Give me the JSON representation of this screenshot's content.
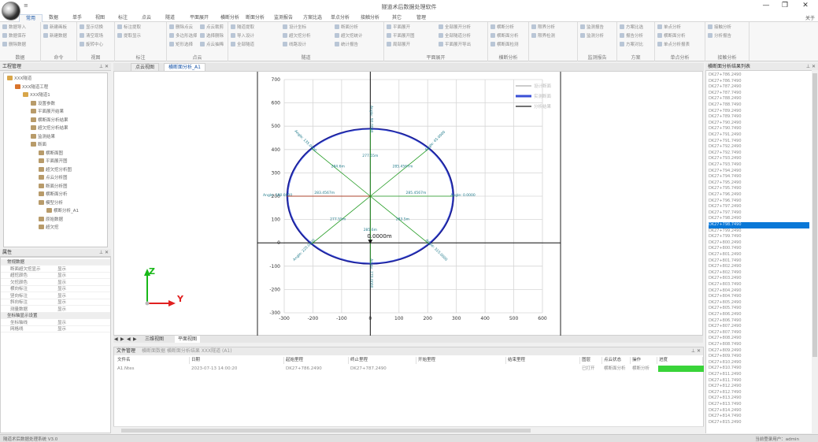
{
  "app": {
    "title": "隧道术后数据处理软件",
    "quick_access": "≡",
    "about": "关于"
  },
  "window_controls": {
    "minimize": "—",
    "restore": "❐",
    "close": "✕"
  },
  "ribbon": {
    "tabs": [
      "常用",
      "数据",
      "单手",
      "视图",
      "标注",
      "点云",
      "隧道",
      "平面展开",
      "横断分析",
      "断面分析",
      "监测报告",
      "方案比选",
      "单点分析",
      "接触分析",
      "其它",
      "管理"
    ],
    "active_tab": "常用",
    "groups": [
      {
        "label": "数据",
        "items": [
          "数据导入",
          "数据保存",
          "删除数据"
        ]
      },
      {
        "label": "命令",
        "items": [
          "新建画板",
          "新建数据"
        ]
      },
      {
        "label": "视图",
        "items": [
          "显示切换",
          "清空现场",
          "旋转中心"
        ]
      },
      {
        "label": "标注",
        "items": [
          "标注提取",
          "提取显示"
        ]
      },
      {
        "label": "点云",
        "items": [
          "删除点云",
          "多边形选择",
          "矩形选择",
          "点云裁剪",
          "选择删除",
          "点云抽稀"
        ]
      },
      {
        "label": "隧道",
        "items": [
          "隧道提取",
          "导入设计",
          "全部隧道",
          "设计坐标",
          "超欠挖分析",
          "线路设计",
          "断面分析",
          "超欠挖统计",
          "统计报告"
        ]
      },
      {
        "label": "平面展开",
        "items": [
          "平面展开",
          "平面展开图",
          "局部展开",
          "全部展开分析",
          "全部隧道分析",
          "平面展开导出"
        ]
      },
      {
        "label": "横断分析",
        "items": [
          "横断分析",
          "横断面分析",
          "横断面检测"
        ]
      },
      {
        "label": "",
        "items": [
          "限界分析",
          "限界检测"
        ]
      },
      {
        "label": "监测报告",
        "items": [
          "监测报告",
          "监测分析"
        ]
      },
      {
        "label": "方案",
        "items": [
          "方案比选",
          "报告分析",
          "方案对比"
        ]
      },
      {
        "label": "单点分析",
        "items": [
          "单点分析",
          "横断面分析",
          "单点分析报表"
        ]
      },
      {
        "label": "接触分析",
        "items": [
          "接触分析",
          "分析报告"
        ]
      }
    ]
  },
  "project_panel": {
    "title": "工程管理",
    "tree": [
      {
        "label": "XXX隧道",
        "depth": 0
      },
      {
        "label": "XXX隧道工程",
        "depth": 1
      },
      {
        "label": "XXX隧道1",
        "depth": 2
      },
      {
        "label": "设置参数",
        "depth": 3
      },
      {
        "label": "平面展开结果",
        "depth": 3
      },
      {
        "label": "横断面分析结果",
        "depth": 3
      },
      {
        "label": "超欠挖分析结果",
        "depth": 3
      },
      {
        "label": "监测结果",
        "depth": 3
      },
      {
        "label": "断面",
        "depth": 3
      },
      {
        "label": "横断面图",
        "depth": 4
      },
      {
        "label": "平面展开图",
        "depth": 4
      },
      {
        "label": "超欠挖分析图",
        "depth": 4
      },
      {
        "label": "点云分析图",
        "depth": 4
      },
      {
        "label": "断面分析图",
        "depth": 4
      },
      {
        "label": "横断面分析",
        "depth": 4
      },
      {
        "label": "模型分析",
        "depth": 4
      },
      {
        "label": "横断分析_A1",
        "depth": 5
      },
      {
        "label": "原始数据",
        "depth": 4
      },
      {
        "label": "超欠挖",
        "depth": 4
      }
    ]
  },
  "properties_panel": {
    "title": "属性",
    "rows": [
      {
        "key": "常规数据",
        "value": "",
        "category": true
      },
      {
        "key": "断面超欠挖显示",
        "value": "显示"
      },
      {
        "key": "超挖颜色",
        "value": "显示"
      },
      {
        "key": "欠挖颜色",
        "value": "显示"
      },
      {
        "key": "横向标注",
        "value": "显示"
      },
      {
        "key": "竖向标注",
        "value": "显示"
      },
      {
        "key": "斜向标注",
        "value": "显示"
      },
      {
        "key": "测量数据",
        "value": "显示"
      },
      {
        "key": "坐标轴显示设置",
        "value": "",
        "category": true
      },
      {
        "key": "坐标轴线",
        "value": "显示"
      },
      {
        "key": "网格线",
        "value": "显示"
      }
    ]
  },
  "document_tabs": {
    "tabs": [
      "点云视图",
      "横断面分析_A1"
    ],
    "active": "横断面分析_A1"
  },
  "bottom_view_tabs": {
    "tabs": [
      "三维视图",
      "平面视图"
    ],
    "active": "平面视图",
    "nav": [
      "◀",
      "▶",
      "◀",
      "▶"
    ]
  },
  "axis_indicator": {
    "z_label": "Z",
    "y_label": "Y"
  },
  "chart_data": {
    "type": "scatter",
    "x_ticks": [
      -300,
      -200,
      -100,
      0,
      100,
      200,
      300,
      400,
      500,
      600
    ],
    "y_ticks": [
      -300,
      -200,
      -100,
      0,
      100,
      200,
      300,
      400,
      500,
      600,
      700
    ],
    "xlim": [
      -300,
      600
    ],
    "ylim": [
      -300,
      700
    ],
    "grid": true,
    "center_label": "0.0000m",
    "center": [
      0,
      200
    ],
    "design_radius": 290,
    "measured_radius": 287,
    "angle_labels": [
      "Angle: 0.0000",
      "Angle: 45.0000",
      "Angle: 90.0000",
      "Angle: 135.0000",
      "Angle: 180.0000",
      "Angle: 225.0000",
      "Angle: 270.0000",
      "Angle: 315.0000"
    ],
    "distance_labels": [
      "285.4567m",
      "285.4567m",
      "277.55m",
      "284.6m",
      "283.4567m",
      "277.55m",
      "285.6m",
      "283.5m"
    ],
    "legend": [
      "设计断面",
      "实测断面",
      "分析结果"
    ],
    "colors": {
      "design": "#14148c",
      "measured": "#3a4fd6",
      "spokes": "#1f9a1f",
      "labels": "#1f7a8a",
      "center_marker": "#cc2222"
    }
  },
  "file_panel": {
    "title": "文件管理",
    "subtitle": "横断面数据 横断面分析结果 XXX隧道 (A1)",
    "columns": [
      "文件名",
      "日期",
      "起始里程",
      "终止里程",
      "开始里程",
      "结束里程",
      "图层",
      "点云状态",
      "操作",
      "进度"
    ],
    "row": [
      "A1.Ntes",
      "2023-07-13 14:00:20",
      "DK27+786.2490",
      "DK27+787.2490",
      "",
      "",
      "已打开",
      "横断面分析",
      "横断分析"
    ],
    "progress": 1.0
  },
  "right_panel": {
    "title": "横断面分析结果列表",
    "items": [
      "DK27+786.2490",
      "DK27+786.7490",
      "DK27+787.2490",
      "DK27+787.7490",
      "DK27+788.2490",
      "DK27+788.7490",
      "DK27+789.2490",
      "DK27+789.7490",
      "DK27+790.2490",
      "DK27+790.7490",
      "DK27+791.2490",
      "DK27+791.7490",
      "DK27+792.2490",
      "DK27+792.7490",
      "DK27+793.2490",
      "DK27+793.7490",
      "DK27+794.2490",
      "DK27+794.7490",
      "DK27+795.2490",
      "DK27+795.7490",
      "DK27+796.2490",
      "DK27+796.7490",
      "DK27+797.2490",
      "DK27+797.7490",
      "DK27+798.2490",
      "DK27+798.7490",
      "DK27+799.2490",
      "DK27+799.7490",
      "DK27+800.2490",
      "DK27+800.7490",
      "DK27+801.2490",
      "DK27+801.7490",
      "DK27+802.2490",
      "DK27+802.7490",
      "DK27+803.2490",
      "DK27+803.7490",
      "DK27+804.2490",
      "DK27+804.7490",
      "DK27+805.2490",
      "DK27+805.7490",
      "DK27+806.2490",
      "DK27+806.7490",
      "DK27+807.2490",
      "DK27+807.7490",
      "DK27+808.2490",
      "DK27+808.7490",
      "DK27+809.2490",
      "DK27+809.7490",
      "DK27+810.2490",
      "DK27+810.7490",
      "DK27+811.2490",
      "DK27+811.7490",
      "DK27+812.2490",
      "DK27+812.7490",
      "DK27+813.2490",
      "DK27+813.7490",
      "DK27+814.2490",
      "DK27+814.7490",
      "DK27+815.2490"
    ],
    "selected_index": 25
  },
  "status": {
    "left": "隧道术后数据处理系统 V3.0",
    "right": "当前登录用户：admin"
  }
}
